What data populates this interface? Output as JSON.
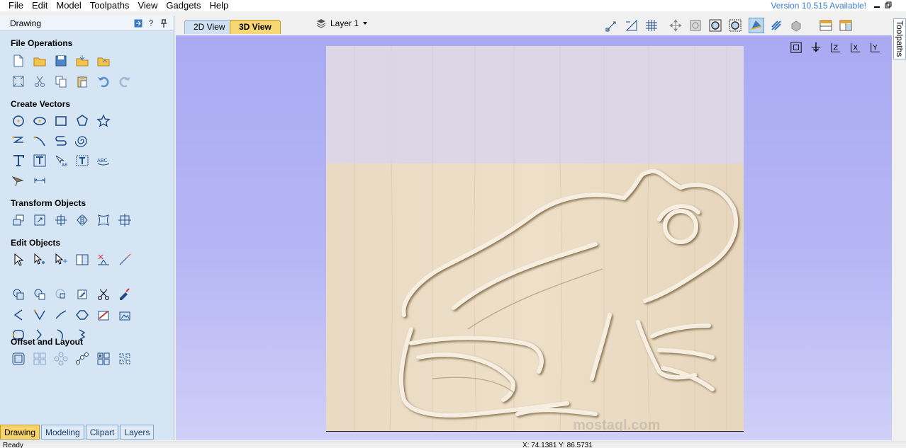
{
  "menu": [
    "File",
    "Edit",
    "Model",
    "Toolpaths",
    "View",
    "Gadgets",
    "Help"
  ],
  "version_text": "Version 10.515 Available!",
  "panel": {
    "title": "Drawing",
    "help": "?",
    "sections": {
      "file": "File Operations",
      "create": "Create Vectors",
      "transform": "Transform Objects",
      "edit": "Edit Objects",
      "offset": "Offset and Layout"
    }
  },
  "bottom_tabs": [
    "Drawing",
    "Modeling",
    "Clipart",
    "Layers"
  ],
  "view_tabs": [
    "2D View",
    "3D View"
  ],
  "layer_label": "Layer 1",
  "right_tab": "Toolpaths",
  "status": {
    "left": "Ready",
    "coord": "X: 74.1381 Y: 86.5731"
  },
  "watermark": "mostaql.com",
  "colors": {
    "panel_bg": "#d6e5f4",
    "active_tab": "#f7d773",
    "viewport_bg": "#a9aaf2",
    "wood": "#eadcc4",
    "version_link": "#3b7fd0"
  }
}
